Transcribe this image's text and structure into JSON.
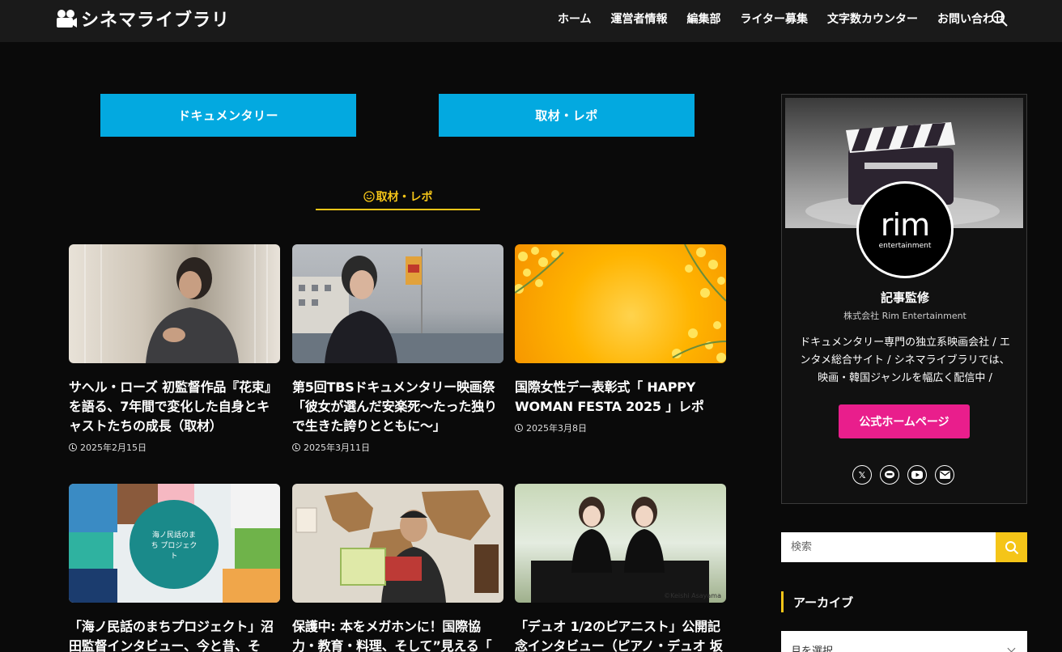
{
  "header": {
    "logo_text": "シネマライブラリ",
    "nav": [
      "ホーム",
      "運営者情報",
      "編集部",
      "ライター募集",
      "文字数カウンター",
      "お問い合わせ"
    ]
  },
  "categories": [
    "ドキュメンタリー",
    "取材・レポ"
  ],
  "section_heading": "取材・レポ",
  "cards": [
    {
      "title": "サヘル・ローズ 初監督作品『花束』を語る、7年間で変化した自身とキャストたちの成長（取材）",
      "date": "2025年2月15日"
    },
    {
      "title": "第5回TBSドキュメンタリー映画祭「彼女が選んだ安楽死〜たった独りで生きた誇りとともに〜」",
      "date": "2025年3月11日"
    },
    {
      "title": "国際女性デー表彰式「 HAPPY WOMAN FESTA 2025 」レポ",
      "date": "2025年3月8日"
    },
    {
      "title": "「海ノ民話のまちプロジェクト」沼田監督インタビュー、今と昔、そ",
      "date": ""
    },
    {
      "title": "保護中: 本をメガホンに！国際協力・教育・料理、そして”見える「",
      "date": ""
    },
    {
      "title": "「デュオ 1/2のピアニスト」公開記念インタビュー（ピアノ・デュオ 坂",
      "date": ""
    }
  ],
  "thumb_texts": {
    "card4_center": "海ノ民話のまち プロジェクト",
    "card6_credit": "©Keishi Asayama"
  },
  "profile": {
    "avatar_main": "rim",
    "avatar_sub": "entertainment",
    "label": "記事監修",
    "company": "株式会社 Rim Entertainment",
    "description": "ドキュメンタリー専門の独立系映画会社 / エンタメ総合サイト / シネマライブラリでは、映画・韓国ジャンルを幅広く配信中 /",
    "home_button": "公式ホームページ",
    "socials": [
      "x-icon",
      "line-icon",
      "youtube-icon",
      "mail-icon"
    ]
  },
  "search": {
    "placeholder": "検索"
  },
  "archive": {
    "heading": "アーカイブ",
    "select_value": "月を選択"
  },
  "colors": {
    "accent_blue": "#03a9e0",
    "accent_yellow": "#f5c518",
    "accent_pink": "#e91e8c",
    "background": "#0a0a0a"
  }
}
